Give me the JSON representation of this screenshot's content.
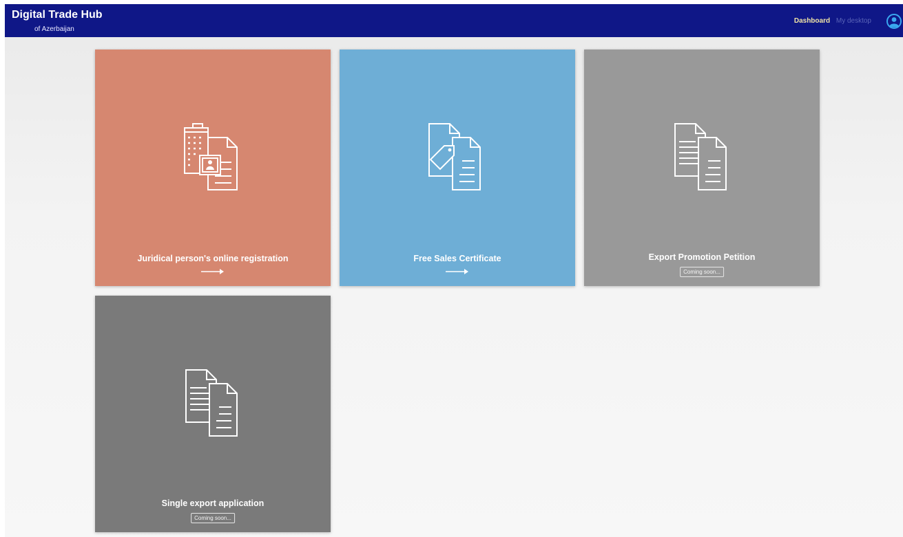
{
  "header": {
    "title": "Digital Trade Hub",
    "subtitle": "of Azerbaijan",
    "nav": {
      "dashboard": "Dashboard",
      "my_desktop": "My desktop"
    }
  },
  "tiles": [
    {
      "label": "Juridical person's online registration",
      "icon": "building-document-icon",
      "color": "#d68770",
      "action": "arrow-right-icon"
    },
    {
      "label": "Free Sales Certificate",
      "icon": "tag-document-icon",
      "color": "#6eaed6",
      "action": "arrow-right-icon"
    },
    {
      "label": "Export Promotion Petition",
      "icon": "documents-icon",
      "color": "#999999",
      "badge": "Coming soon..."
    },
    {
      "label": "Single export application",
      "icon": "documents-icon",
      "color": "#7a7a7a",
      "badge": "Coming soon..."
    }
  ],
  "colors": {
    "header_bg": "#0f1787",
    "page_bg": "#f2f2f2"
  }
}
